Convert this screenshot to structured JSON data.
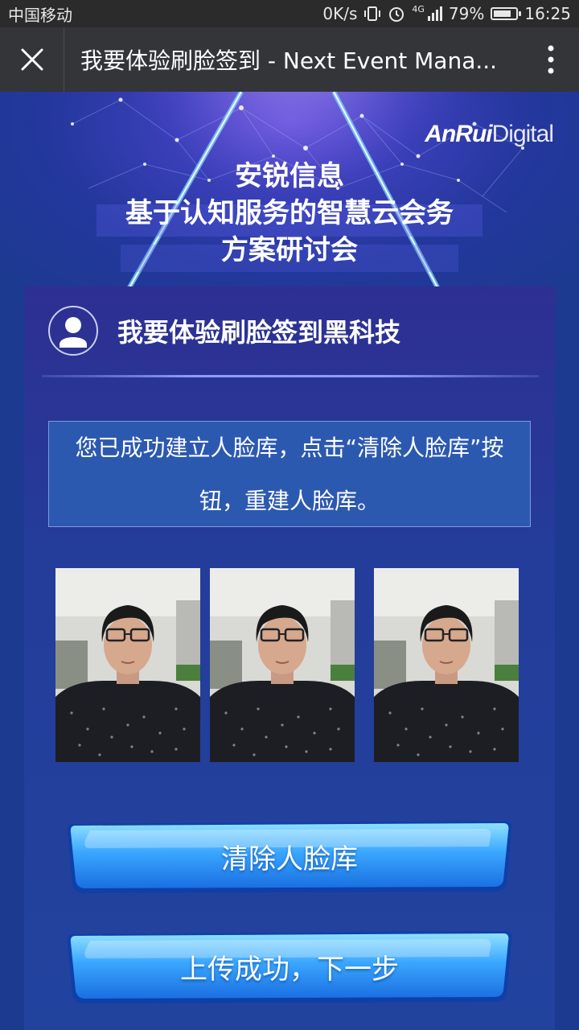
{
  "status_bar": {
    "carrier": "中国移动",
    "net_speed": "0K/s",
    "network": "4G",
    "battery": "79%",
    "battery_level": 0.79,
    "time": "16:25"
  },
  "title_bar": {
    "title": "我要体验刷脸签到 - Next Event Mana..."
  },
  "hero": {
    "brand_bold": "AnRui",
    "brand_light": "Digital",
    "title_lines": [
      "安锐信息",
      "基于认知服务的智慧云会务",
      "方案研讨会"
    ]
  },
  "panel": {
    "title": "我要体验刷脸签到黑科技",
    "notice_line1": "您已成功建立人脸库，点击“清除人脸库”按",
    "notice_line2": "钮，重建人脸库。"
  },
  "photos": [
    "face-photo-1",
    "face-photo-2",
    "face-photo-3"
  ],
  "buttons": {
    "clear": "清除人脸库",
    "next": "上传成功，下一步"
  },
  "colors": {
    "background": "#1c3a8f",
    "panel": "#243c9a",
    "notice": "#2c59b0",
    "button": "#3aa6ff",
    "title_bar": "#333538"
  }
}
